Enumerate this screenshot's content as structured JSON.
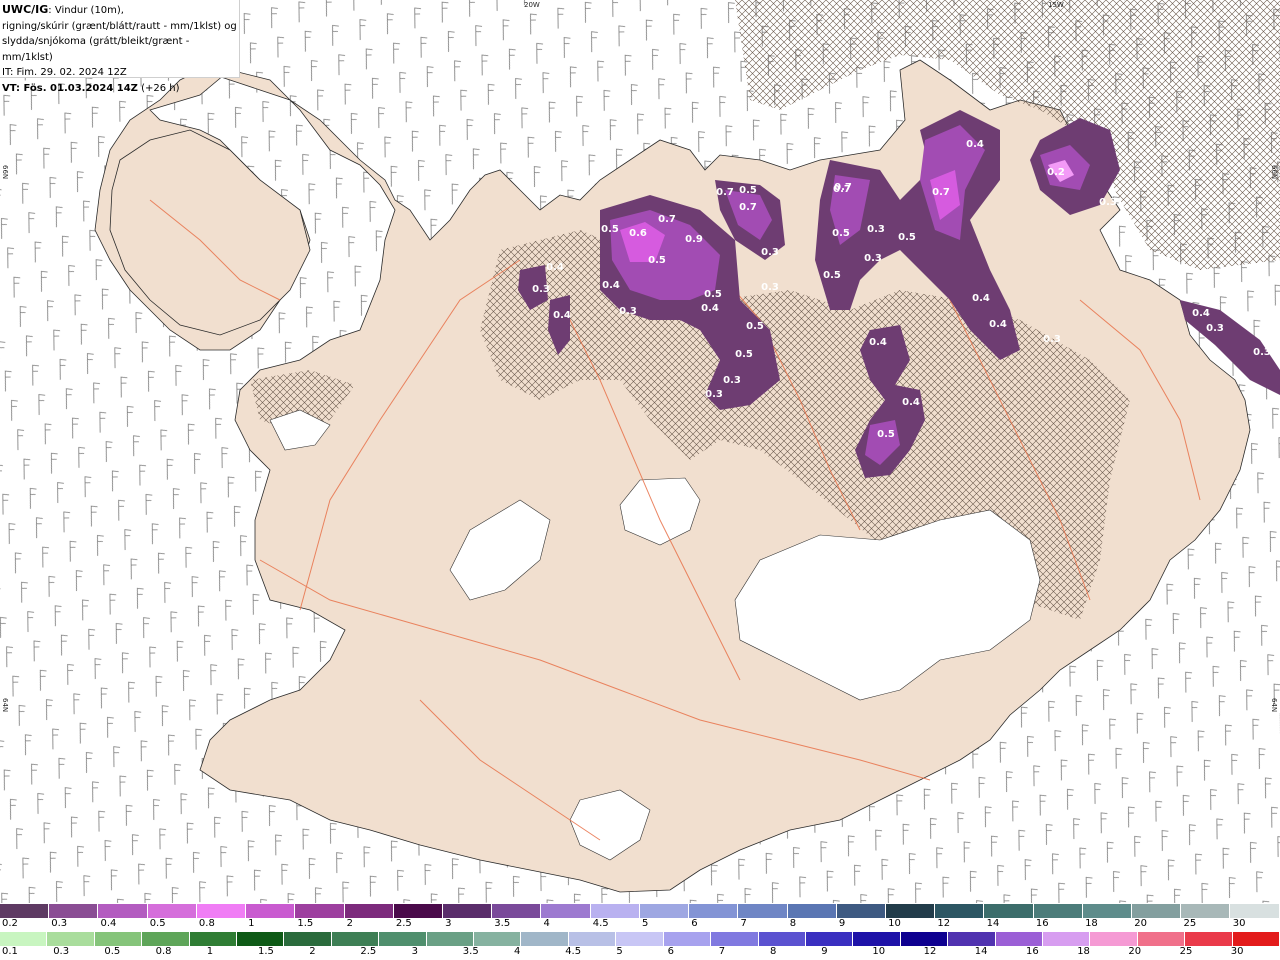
{
  "header": {
    "model": "UWC/IG",
    "line1_rest": ": Vindur (10m),",
    "line2": "rigning/skúrir (grænt/blátt/rautt - mm/1klst) og",
    "line3": "slydda/snjókoma (grátt/bleikt/grænt - mm/1klst)",
    "line4": "IT: Fim. 29. 02. 2024 12Z",
    "line5_bold": "VT: Fös. 01.03.2024 14Z",
    "line5_rest": " (+26 h)"
  },
  "grid_labels": {
    "top_20w": "20W",
    "top_15w": "15W",
    "left_66n": "66N",
    "left_64n": "64N",
    "right_66n": "66N",
    "right_64n": "64N"
  },
  "colors": {
    "land": "#f1dfcf",
    "roads": "#e8724a",
    "glacier": "#ffffff",
    "precip_dark": "#6e3d72",
    "precip_mid": "#a24cb3",
    "precip_light": "#d65bdf",
    "precip_bright": "#f39af7"
  },
  "precip_values": [
    "0.4",
    "0.7",
    "0.7",
    "0.5",
    "0.7",
    "0.7",
    "0.5",
    "0.9",
    "0.6",
    "0.5",
    "0.3",
    "0.4",
    "0.3",
    "0.4",
    "0.5",
    "0.5",
    "0.4",
    "0.3",
    "0.5",
    "0.3",
    "0.3",
    "0.3",
    "0.5",
    "0.5",
    "0.3",
    "0.4",
    "0.5",
    "0.7",
    "0.7",
    "0.4",
    "0.4",
    "0.2",
    "0.3",
    "0.4",
    "0.5",
    "0.4",
    "0.4",
    "0.3",
    "0.3",
    "0.3",
    "0.3"
  ],
  "snow_scale": {
    "colors": [
      "#5e3a63",
      "#8a4d94",
      "#b35cc0",
      "#d56edb",
      "#f07df5",
      "#c95bd0",
      "#9d3f9f",
      "#7c2a7c",
      "#4a0a4a",
      "#5a2d6b",
      "#7a4a9a",
      "#9d7ad0",
      "#b9b1f0",
      "#9ea7e2",
      "#8394d5",
      "#6f86c5",
      "#5a76b3",
      "#3e5a82",
      "#223c4a",
      "#2c5663",
      "#3c6d6b",
      "#4c7c7a",
      "#5e8c8b",
      "#839f9f",
      "#a8b8b8",
      "#d8e0e0"
    ],
    "labels": [
      "0.2",
      "0.3",
      "0.4",
      "0.5",
      "0.8",
      "1",
      "1.5",
      "2",
      "2.5",
      "3",
      "3.5",
      "4",
      "4.5",
      "5",
      "6",
      "7",
      "8",
      "9",
      "10",
      "12",
      "14",
      "16",
      "18",
      "20",
      "25",
      "30"
    ]
  },
  "rain_scale": {
    "colors": [
      "#c8f5c0",
      "#a9dd9c",
      "#85c47a",
      "#5ea559",
      "#2f7d34",
      "#0e5a16",
      "#2a6b3c",
      "#3e7f55",
      "#4f8f6d",
      "#6aa085",
      "#86b2a0",
      "#a0b6c8",
      "#b8c0e6",
      "#c8c6f5",
      "#a7a2ee",
      "#8079e0",
      "#5b52d0",
      "#3a2fc0",
      "#1e12a8",
      "#0e0090",
      "#5032b0",
      "#9b5fd6",
      "#d79df0",
      "#f59ad4",
      "#f0708a",
      "#ea3a4a",
      "#e31b1b"
    ],
    "labels": [
      "0.1",
      "0.3",
      "0.5",
      "0.8",
      "1",
      "1.5",
      "2",
      "2.5",
      "3",
      "3.5",
      "4",
      "4.5",
      "5",
      "6",
      "7",
      "8",
      "9",
      "10",
      "12",
      "14",
      "16",
      "18",
      "20",
      "25",
      "30"
    ]
  }
}
